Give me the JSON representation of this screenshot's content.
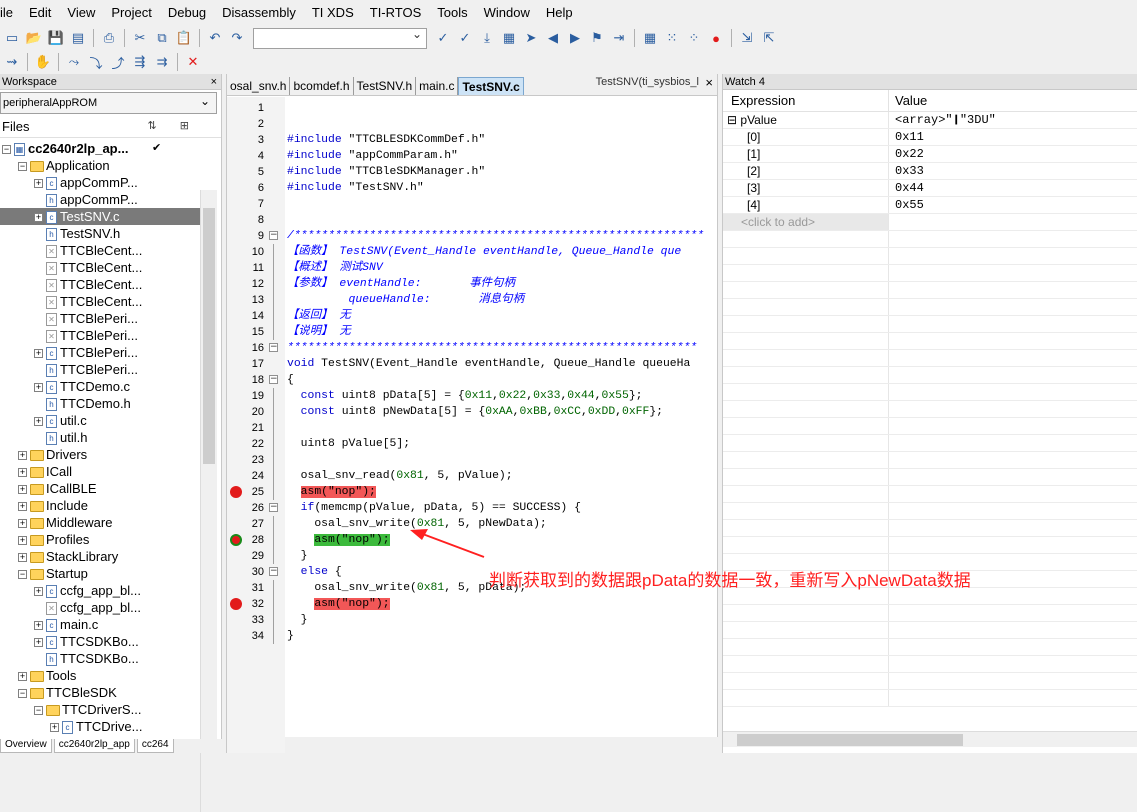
{
  "menu": [
    "ile",
    "Edit",
    "View",
    "Project",
    "Debug",
    "Disassembly",
    "TI XDS",
    "TI-RTOS",
    "Tools",
    "Window",
    "Help"
  ],
  "workspace": {
    "title": "Workspace",
    "close": "×",
    "config": "peripheralAppROM",
    "files_header": "Files",
    "tree": [
      {
        "depth": 0,
        "toggle": "−",
        "icon": "proj",
        "label": "cc2640r2lp_ap...",
        "bold": true,
        "check": "✔"
      },
      {
        "depth": 1,
        "toggle": "−",
        "icon": "folder",
        "label": "Application"
      },
      {
        "depth": 2,
        "toggle": "+",
        "icon": "c",
        "label": "appCommP..."
      },
      {
        "depth": 2,
        "toggle": "",
        "icon": "h",
        "label": "appCommP..."
      },
      {
        "depth": 2,
        "toggle": "+",
        "icon": "c",
        "label": "TestSNV.c",
        "selected": true
      },
      {
        "depth": 2,
        "toggle": "",
        "icon": "h",
        "label": "TestSNV.h"
      },
      {
        "depth": 2,
        "toggle": "",
        "icon": "x",
        "label": "TTCBleCent..."
      },
      {
        "depth": 2,
        "toggle": "",
        "icon": "x",
        "label": "TTCBleCent..."
      },
      {
        "depth": 2,
        "toggle": "",
        "icon": "x",
        "label": "TTCBleCent..."
      },
      {
        "depth": 2,
        "toggle": "",
        "icon": "x",
        "label": "TTCBleCent..."
      },
      {
        "depth": 2,
        "toggle": "",
        "icon": "x",
        "label": "TTCBlePeri..."
      },
      {
        "depth": 2,
        "toggle": "",
        "icon": "x",
        "label": "TTCBlePeri..."
      },
      {
        "depth": 2,
        "toggle": "+",
        "icon": "c",
        "label": "TTCBlePeri..."
      },
      {
        "depth": 2,
        "toggle": "",
        "icon": "h",
        "label": "TTCBlePeri..."
      },
      {
        "depth": 2,
        "toggle": "+",
        "icon": "c",
        "label": "TTCDemo.c"
      },
      {
        "depth": 2,
        "toggle": "",
        "icon": "h",
        "label": "TTCDemo.h"
      },
      {
        "depth": 2,
        "toggle": "+",
        "icon": "c",
        "label": "util.c"
      },
      {
        "depth": 2,
        "toggle": "",
        "icon": "h",
        "label": "util.h"
      },
      {
        "depth": 1,
        "toggle": "+",
        "icon": "folder",
        "label": "Drivers"
      },
      {
        "depth": 1,
        "toggle": "+",
        "icon": "folder",
        "label": "ICall"
      },
      {
        "depth": 1,
        "toggle": "+",
        "icon": "folder",
        "label": "ICallBLE"
      },
      {
        "depth": 1,
        "toggle": "+",
        "icon": "folder",
        "label": "Include"
      },
      {
        "depth": 1,
        "toggle": "+",
        "icon": "xfolder",
        "label": "Middleware"
      },
      {
        "depth": 1,
        "toggle": "+",
        "icon": "folder",
        "label": "Profiles"
      },
      {
        "depth": 1,
        "toggle": "+",
        "icon": "folder",
        "label": "StackLibrary"
      },
      {
        "depth": 1,
        "toggle": "−",
        "icon": "folder",
        "label": "Startup"
      },
      {
        "depth": 2,
        "toggle": "+",
        "icon": "c",
        "label": "ccfg_app_bl..."
      },
      {
        "depth": 2,
        "toggle": "",
        "icon": "x",
        "label": "ccfg_app_bl..."
      },
      {
        "depth": 2,
        "toggle": "+",
        "icon": "c",
        "label": "main.c"
      },
      {
        "depth": 2,
        "toggle": "+",
        "icon": "c",
        "label": "TTCSDKBo..."
      },
      {
        "depth": 2,
        "toggle": "",
        "icon": "h",
        "label": "TTCSDKBo..."
      },
      {
        "depth": 1,
        "toggle": "+",
        "icon": "folder",
        "label": "Tools"
      },
      {
        "depth": 1,
        "toggle": "−",
        "icon": "folder",
        "label": "TTCBleSDK"
      },
      {
        "depth": 2,
        "toggle": "−",
        "icon": "folder",
        "label": "TTCDriverS..."
      },
      {
        "depth": 3,
        "toggle": "+",
        "icon": "c",
        "label": "TTCDrive..."
      }
    ],
    "bottom_tabs": [
      "Overview",
      "cc2640r2lp_app",
      "cc264"
    ]
  },
  "editor": {
    "tabs": [
      "osal_snv.h",
      "bcomdef.h",
      "TestSNV.h",
      "main.c",
      "TestSNV.c"
    ],
    "active_tab": "TestSNV.c",
    "function_box": "TestSNV(ti_sysbios_l",
    "close": "×",
    "lines": [
      {
        "n": "1",
        "html": ""
      },
      {
        "n": "2",
        "html": ""
      },
      {
        "n": "3",
        "html": "<span class=kw>#include</span> \"TTCBLESDKCommDef.h\""
      },
      {
        "n": "4",
        "html": "<span class=kw>#include</span> \"appCommParam.h\""
      },
      {
        "n": "5",
        "html": "<span class=kw>#include</span> \"TTCBleSDKManager.h\""
      },
      {
        "n": "6",
        "html": "<span class=kw>#include</span> \"TestSNV.h\""
      },
      {
        "n": "7",
        "html": ""
      },
      {
        "n": "8",
        "html": ""
      },
      {
        "n": "9",
        "fold": "−",
        "html": "<span class=cm>/************************************************************</span>"
      },
      {
        "n": "10",
        "bar": true,
        "html": "<span class=cm>【函数】 TestSNV(Event_Handle eventHandle, Queue_Handle que</span>"
      },
      {
        "n": "11",
        "bar": true,
        "html": "<span class=cm>【概述】 测试SNV</span>"
      },
      {
        "n": "12",
        "bar": true,
        "html": "<span class=cm>【参数】 eventHandle:       事件句柄</span>"
      },
      {
        "n": "13",
        "bar": true,
        "html": "<span class=cm>         queueHandle:       消息句柄</span>"
      },
      {
        "n": "14",
        "bar": true,
        "html": "<span class=cm>【返回】 无</span>"
      },
      {
        "n": "15",
        "bar": true,
        "html": "<span class=cm>【说明】 无</span>"
      },
      {
        "n": "16",
        "fold": "−",
        "html": "<span class=cm>************************************************************</span>"
      },
      {
        "n": "17",
        "html": "<span class=kw>void</span> TestSNV(Event_Handle eventHandle, Queue_Handle queueHa"
      },
      {
        "n": "18",
        "fold": "−",
        "html": "{"
      },
      {
        "n": "19",
        "bar": true,
        "html": "  <span class=kw>const</span> uint8 pData[5] = {<span class=hx>0x11</span>,<span class=hx>0x22</span>,<span class=hx>0x33</span>,<span class=hx>0x44</span>,<span class=hx>0x55</span>};"
      },
      {
        "n": "20",
        "bar": true,
        "html": "  <span class=kw>const</span> uint8 pNewData[5] = {<span class=hx>0xAA</span>,<span class=hx>0xBB</span>,<span class=hx>0xCC</span>,<span class=hx>0xDD</span>,<span class=hx>0xFF</span>};"
      },
      {
        "n": "21",
        "bar": true,
        "html": ""
      },
      {
        "n": "22",
        "bar": true,
        "html": "  uint8 pValue[5];"
      },
      {
        "n": "23",
        "bar": true,
        "html": ""
      },
      {
        "n": "24",
        "bar": true,
        "html": "  osal_snv_read(<span class=hx>0x81</span>, 5, pValue);"
      },
      {
        "n": "25",
        "bar": true,
        "bp": "red",
        "html": "  <span class=hl-red>asm(\"nop\");</span>"
      },
      {
        "n": "26",
        "fold": "−",
        "html": "  <span class=kw>if</span>(memcmp(pValue, pData, 5) == SUCCESS) {"
      },
      {
        "n": "27",
        "bar": true,
        "html": "    osal_snv_write(<span class=hx>0x81</span>, 5, pNewData);"
      },
      {
        "n": "28",
        "bar": true,
        "bp": "cur",
        "html": "    <span class=hl-green>asm(\"nop\");</span>"
      },
      {
        "n": "29",
        "bar": true,
        "html": "  }"
      },
      {
        "n": "30",
        "fold": "−",
        "html": "  <span class=kw>else</span> {"
      },
      {
        "n": "31",
        "bar": true,
        "html": "    osal_snv_write(<span class=hx>0x81</span>, 5, pData);"
      },
      {
        "n": "32",
        "bar": true,
        "bp": "red",
        "html": "    <span class=hl-red>asm(\"nop\");</span>"
      },
      {
        "n": "33",
        "bar": true,
        "html": "  }"
      },
      {
        "n": "34",
        "bar": true,
        "html": "}"
      }
    ]
  },
  "watch": {
    "title": "Watch 4",
    "headers": {
      "expression": "Expression",
      "value": "Value"
    },
    "rows": [
      {
        "expr": "⊟ pValue",
        "value": "<array>\"❙\"3DU\""
      },
      {
        "expr": "      [0]",
        "value": "0x11"
      },
      {
        "expr": "      [1]",
        "value": "0x22"
      },
      {
        "expr": "      [2]",
        "value": "0x33"
      },
      {
        "expr": "      [3]",
        "value": "0x44"
      },
      {
        "expr": "      [4]",
        "value": "0x55"
      }
    ],
    "add_row": "<click to add>"
  },
  "annotation": "判断获取到的数据跟pData的数据一致，重新写入pNewData数据",
  "colors": {
    "breakpoint": "#e21b1b",
    "current_line": "#3cba3c",
    "annotation": "#ff2020"
  }
}
